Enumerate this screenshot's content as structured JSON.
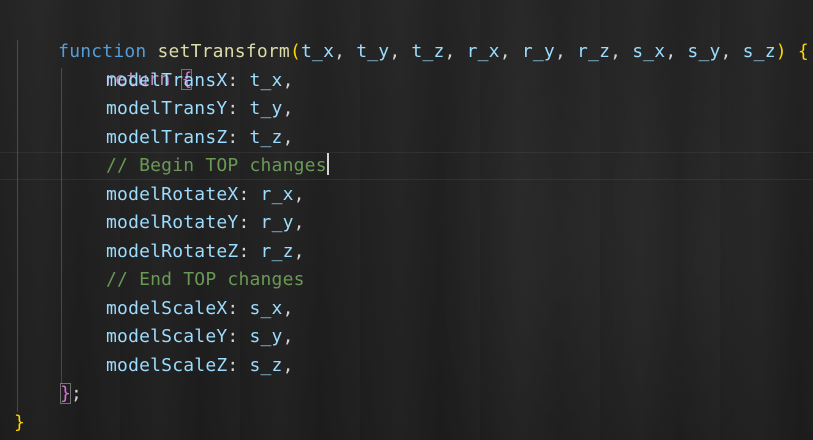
{
  "editor": {
    "line1": {
      "keyword": "function",
      "name": "setTransform",
      "open_paren": "(",
      "params": [
        "t_x",
        "t_y",
        "t_z",
        "r_x",
        "r_y",
        "r_z",
        "s_x",
        "s_y",
        "s_z"
      ],
      "separator": ", ",
      "close_paren": ")",
      "open_brace": "{"
    },
    "line2": {
      "keyword": "return",
      "open_brace": "{"
    },
    "entries": [
      {
        "key": "modelTransX",
        "value": "t_x"
      },
      {
        "key": "modelTransY",
        "value": "t_y"
      },
      {
        "key": "modelTransZ",
        "value": "t_z"
      },
      {
        "comment": "// Begin TOP changes"
      },
      {
        "key": "modelRotateX",
        "value": "r_x"
      },
      {
        "key": "modelRotateY",
        "value": "r_y"
      },
      {
        "key": "modelRotateZ",
        "value": "r_z"
      },
      {
        "comment": "// End TOP changes"
      },
      {
        "key": "modelScaleX",
        "value": "s_x"
      },
      {
        "key": "modelScaleY",
        "value": "s_y"
      },
      {
        "key": "modelScaleZ",
        "value": "s_z"
      }
    ],
    "colon": ": ",
    "comma": ",",
    "close_inner": "}",
    "semicolon": ";",
    "close_outer": "}"
  }
}
